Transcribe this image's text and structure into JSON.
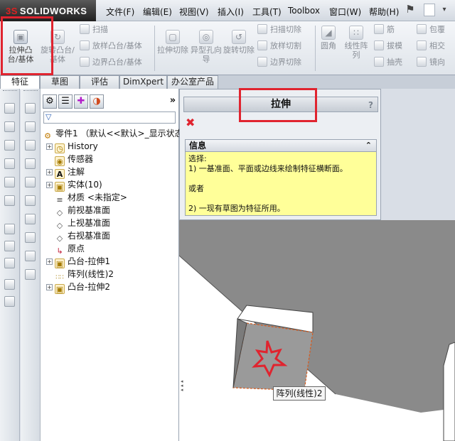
{
  "app": {
    "logo_prefix": "3S",
    "logo_name": "SOLIDWORKS"
  },
  "menu": [
    "文件(F)",
    "编辑(E)",
    "视图(V)",
    "插入(I)",
    "工具(T)",
    "Toolbox",
    "窗口(W)",
    "帮助(H)"
  ],
  "toolbar": {
    "extrude_boss": "拉伸凸台/基体",
    "revolve_boss": "旋转凸台/基体",
    "sweep": "扫描",
    "loft_boss": "放样凸台/基体",
    "boundary_boss": "边界凸台/基体",
    "extrude_cut": "拉伸切除",
    "hole_wizard": "异型孔向导",
    "revolve_cut": "旋转切除",
    "swept_cut": "扫描切除",
    "lofted_cut": "放样切割",
    "boundary_cut": "边界切除",
    "fillet": "圆角",
    "linear_pattern": "线性阵列",
    "rib": "筋",
    "draft": "拔模",
    "shell": "抽壳",
    "wrap": "包覆",
    "intersect": "相交",
    "mirror": "镜向"
  },
  "tabs": [
    "特征",
    "草图",
    "评估",
    "DimXpert",
    "办公室产品"
  ],
  "tree": {
    "part": "零件1 （默认<<默认>_显示状态",
    "items": [
      {
        "label": "History",
        "icon": "history-icon",
        "expandable": true
      },
      {
        "label": "传感器",
        "icon": "sensor-icon",
        "expandable": false
      },
      {
        "label": "注解",
        "icon": "annotation-icon",
        "expandable": true
      },
      {
        "label": "实体(10)",
        "icon": "solid-bodies-icon",
        "expandable": true
      },
      {
        "label": "材质 <未指定>",
        "icon": "material-icon",
        "expandable": false
      },
      {
        "label": "前视基准面",
        "icon": "plane-icon",
        "expandable": false
      },
      {
        "label": "上视基准面",
        "icon": "plane-icon",
        "expandable": false
      },
      {
        "label": "右视基准面",
        "icon": "plane-icon",
        "expandable": false
      },
      {
        "label": "原点",
        "icon": "origin-icon",
        "expandable": false
      },
      {
        "label": "凸台-拉伸1",
        "icon": "extrude-feature-icon",
        "expandable": true
      },
      {
        "label": "阵列(线性)2",
        "icon": "linear-pattern-icon",
        "expandable": false
      },
      {
        "label": "凸台-拉伸2",
        "icon": "extrude-feature-icon",
        "expandable": true
      }
    ]
  },
  "property_manager": {
    "title": "拉伸",
    "help": "?",
    "info_title": "信息",
    "info_lines": [
      "选择:",
      "1) 一基准面、平面或边线来绘制特征横断面。",
      "",
      "或者",
      "",
      "2) 一现有草图为特征所用。"
    ]
  },
  "viewport": {
    "tooltip": "阵列(线性)2"
  },
  "colors": {
    "highlight": "#e0242f",
    "info_bg": "#ffff99",
    "model_face": "#8a8a8a",
    "star": "#e0242f"
  }
}
